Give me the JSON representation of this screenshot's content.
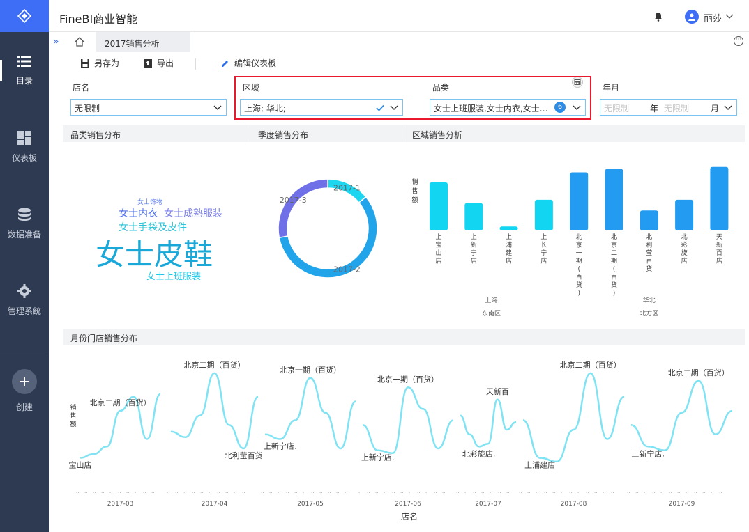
{
  "app": {
    "title": "FineBI商业智能",
    "user": "丽莎"
  },
  "nav": [
    {
      "label": "目录",
      "icon": "list-icon"
    },
    {
      "label": "仪表板",
      "icon": "dashboard-icon"
    },
    {
      "label": "数据准备",
      "icon": "database-icon"
    },
    {
      "label": "管理系统",
      "icon": "gear-icon"
    },
    {
      "label": "创建",
      "icon": "plus-icon"
    }
  ],
  "tabs": {
    "active": "2017销售分析"
  },
  "toolbar": {
    "save_as": "另存为",
    "export": "导出",
    "edit": "编辑仪表板"
  },
  "filters": {
    "store": {
      "label": "店名",
      "value": "无限制"
    },
    "region": {
      "label": "区域",
      "value": "上海; 华北;"
    },
    "category": {
      "label": "品类",
      "value": "女士上班服装,女士内衣,女士…",
      "count": "6"
    },
    "yearmonth": {
      "label": "年月",
      "year_placeholder": "无限制",
      "year_unit": "年",
      "month_placeholder": "无限制",
      "month_unit": "月"
    }
  },
  "widgets": {
    "wordcloud": {
      "title": "品类销售分布",
      "words": [
        {
          "text": "女士饰物",
          "color": "#5b7be8"
        },
        {
          "text": "女士内衣",
          "color": "#4f6fe6"
        },
        {
          "text": "女士成熟服装",
          "color": "#7a7fe8"
        },
        {
          "text": "女士手袋及皮件",
          "color": "#2ec3d8"
        },
        {
          "text": "女士皮鞋",
          "color": "#1aa8d8"
        },
        {
          "text": "女士上班服装",
          "color": "#22c9e8"
        }
      ]
    },
    "donut": {
      "title": "季度销售分布"
    },
    "bar": {
      "title": "区域销售分析"
    },
    "line": {
      "title": "月份门店销售分布"
    }
  },
  "chart_data": [
    {
      "type": "pie",
      "title": "季度销售分布",
      "categories": [
        "2017-1",
        "2017-2",
        "2017-3"
      ],
      "values": [
        14,
        58,
        28
      ],
      "colors": [
        "#1fd6f0",
        "#22a4ea",
        "#6f6fe8"
      ]
    },
    {
      "type": "bar",
      "title": "区域销售分析",
      "ylabel": "销售额",
      "categories": [
        "上宝山店",
        "上新宁店",
        "上浦建店",
        "上长宁店",
        "北京一期(百货)",
        "北京二期(百货)",
        "北利莹百货",
        "北彩旋店",
        "天新百店"
      ],
      "values": [
        72,
        41,
        6,
        46,
        87,
        92,
        30,
        46,
        95
      ],
      "groups": [
        {
          "name": "上海",
          "sub": "东南区",
          "count": 4
        },
        {
          "name": "华北",
          "sub": "北方区",
          "count": 5
        }
      ]
    },
    {
      "type": "line",
      "title": "月份门店销售分布",
      "xlabel": "店名",
      "ylabel": "销售额",
      "months": [
        "2017-03",
        "2017-04",
        "2017-05",
        "2017-06",
        "2017-07",
        "2017-08",
        "2017-09"
      ],
      "panels": [
        {
          "month": "2017-03",
          "values": [
            10,
            14,
            22,
            60,
            75,
            30,
            78
          ],
          "labels": [
            {
              "text": "宝山店",
              "at": 0,
              "pos": "below"
            },
            {
              "text": "北京二期（百货）",
              "at": 3,
              "pos": "above"
            }
          ]
        },
        {
          "month": "2017-04",
          "values": [
            38,
            32,
            55,
            100,
            45,
            20,
            75
          ],
          "labels": [
            {
              "text": "北京二期（百货）",
              "at": 3,
              "pos": "above"
            },
            {
              "text": "北利莹百货",
              "at": 5,
              "pos": "below"
            }
          ]
        },
        {
          "month": "2017-05",
          "values": [
            35,
            30,
            50,
            95,
            58,
            20,
            70
          ],
          "labels": [
            {
              "text": "北京一期（百货）",
              "at": 3,
              "pos": "above"
            },
            {
              "text": "上新宁店.",
              "at": 1,
              "pos": "below"
            }
          ]
        },
        {
          "month": "2017-06",
          "values": [
            45,
            18,
            15,
            85,
            62,
            20,
            50
          ],
          "labels": [
            {
              "text": "北京一期（百货）",
              "at": 3,
              "pos": "above"
            },
            {
              "text": "上新宁店.",
              "at": 1,
              "pos": "below"
            }
          ]
        },
        {
          "month": "2017-07",
          "values": [
            55,
            35,
            22,
            25,
            72,
            40,
            48
          ],
          "labels": [
            {
              "text": "天新百",
              "at": 4,
              "pos": "above"
            },
            {
              "text": "北彩旋店.",
              "at": 2,
              "pos": "below"
            }
          ]
        },
        {
          "month": "2017-08",
          "values": [
            50,
            10,
            6,
            40,
            100,
            30,
            75
          ],
          "labels": [
            {
              "text": "北京二期（百货）",
              "at": 4,
              "pos": "above"
            },
            {
              "text": "上浦建店",
              "at": 1,
              "pos": "below"
            }
          ]
        },
        {
          "month": "2017-09",
          "values": [
            45,
            22,
            18,
            58,
            92,
            35,
            60
          ],
          "labels": [
            {
              "text": "北京二期（百货）",
              "at": 4,
              "pos": "above"
            },
            {
              "text": "上新宁店.",
              "at": 1,
              "pos": "below"
            }
          ]
        }
      ]
    }
  ]
}
